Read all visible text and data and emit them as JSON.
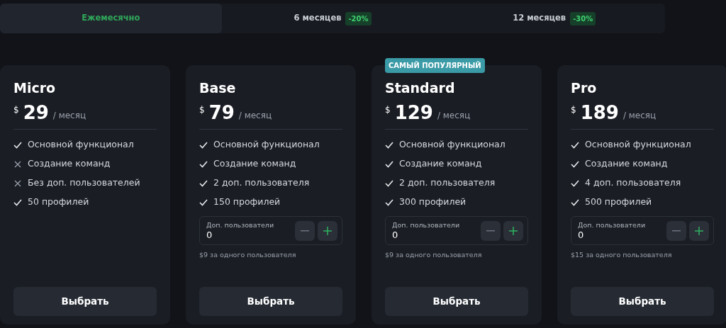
{
  "billing_tabs": [
    {
      "label": "Ежемесячно",
      "selected": true
    },
    {
      "label": "6 месяцев",
      "discount": "-20%",
      "selected": false
    },
    {
      "label": "12 месяцев",
      "discount": "-30%",
      "selected": false
    }
  ],
  "plans": [
    {
      "name": "Micro",
      "currency": "$",
      "price": "29",
      "period": "/ месяц",
      "features": [
        {
          "text": "Основной функционал",
          "included": true
        },
        {
          "text": "Создание команд",
          "included": false
        },
        {
          "text": "Без доп. пользователей",
          "included": false
        },
        {
          "text": "50 профилей",
          "included": true
        }
      ],
      "button": "Выбрать"
    },
    {
      "name": "Base",
      "currency": "$",
      "price": "79",
      "period": "/ месяц",
      "features": [
        {
          "text": "Основной функционал",
          "included": true
        },
        {
          "text": "Создание команд",
          "included": true
        },
        {
          "text": "2 доп. пользователя",
          "included": true
        },
        {
          "text": "150 профилей",
          "included": true
        }
      ],
      "extra_users": {
        "label": "Доп. пользователи",
        "value": "0",
        "note": "$9 за одного пользователя"
      },
      "button": "Выбрать"
    },
    {
      "name": "Standard",
      "badge": "САМЫЙ ПОПУЛЯРНЫЙ",
      "currency": "$",
      "price": "129",
      "period": "/ месяц",
      "features": [
        {
          "text": "Основной функционал",
          "included": true
        },
        {
          "text": "Создание команд",
          "included": true
        },
        {
          "text": "2 доп. пользователя",
          "included": true
        },
        {
          "text": "300 профилей",
          "included": true
        }
      ],
      "extra_users": {
        "label": "Доп. пользователи",
        "value": "0",
        "note": "$9 за одного пользователя"
      },
      "button": "Выбрать"
    },
    {
      "name": "Pro",
      "currency": "$",
      "price": "189",
      "period": "/ месяц",
      "features": [
        {
          "text": "Основной функционал",
          "included": true
        },
        {
          "text": "Создание команд",
          "included": true
        },
        {
          "text": "4 доп. пользователя",
          "included": true
        },
        {
          "text": "500 профилей",
          "included": true
        }
      ],
      "extra_users": {
        "label": "Доп. пользователи",
        "value": "0",
        "note": "$15 за одного пользователя"
      },
      "button": "Выбрать"
    }
  ]
}
